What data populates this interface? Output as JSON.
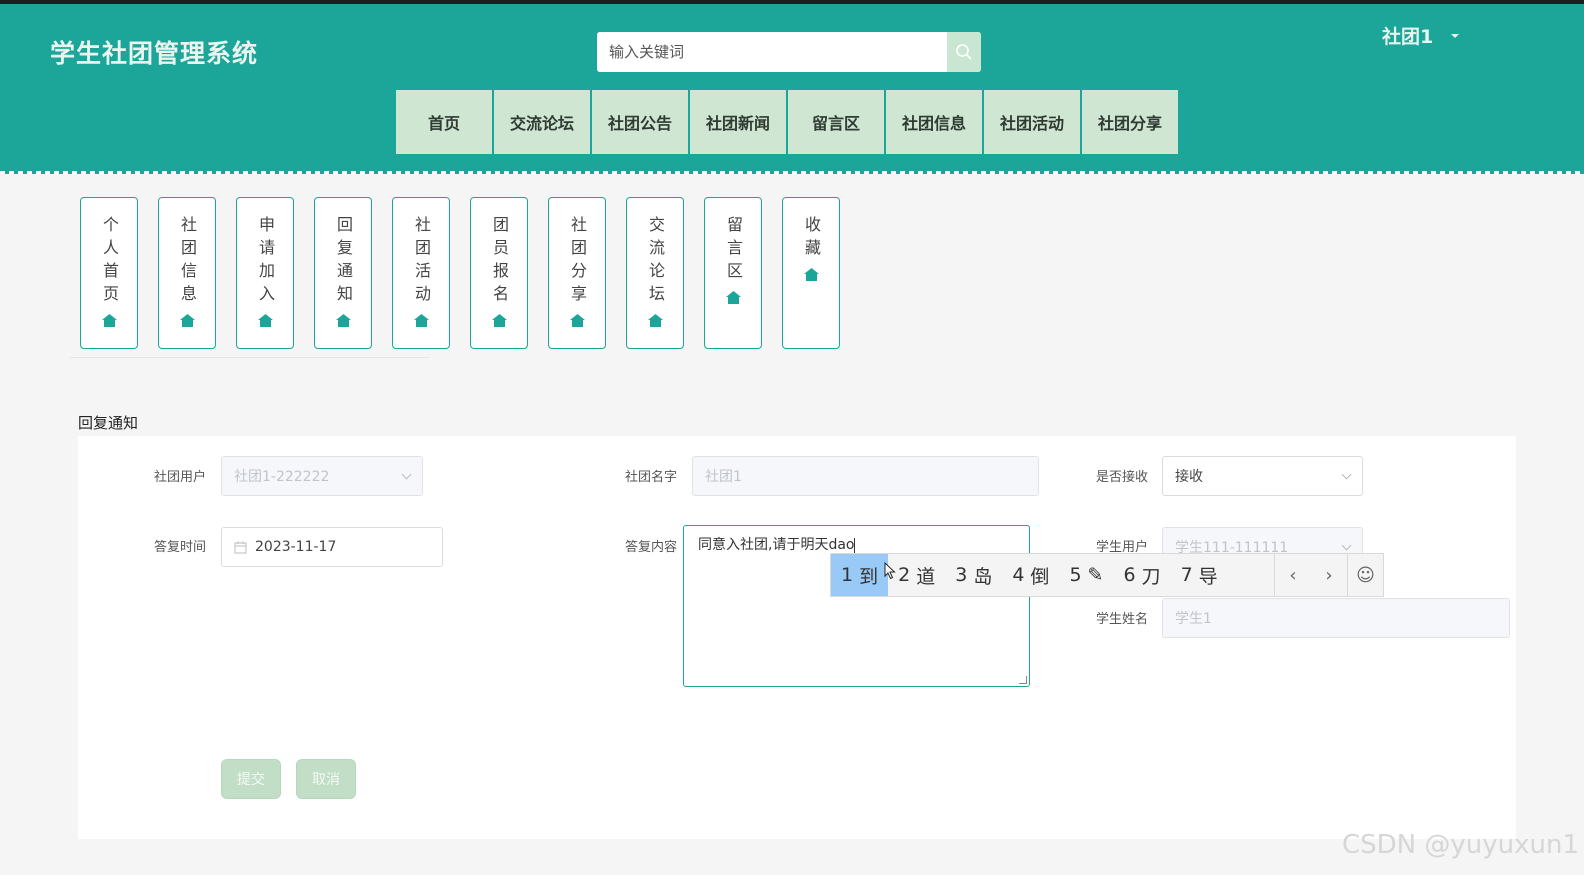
{
  "header": {
    "brand": "学生社团管理系统",
    "search_placeholder": "输入关键词",
    "user": "社团1",
    "nav": [
      "首页",
      "交流论坛",
      "社团公告",
      "社团新闻",
      "留言区",
      "社团信息",
      "社团活动",
      "社团分享"
    ]
  },
  "tiles": [
    "个人首页",
    "社团信息",
    "申请加入",
    "回复通知",
    "社团活动",
    "团员报名",
    "社团分享",
    "交流论坛",
    "留言区",
    "收藏"
  ],
  "form": {
    "title": "回复通知",
    "club_user_label": "社团用户",
    "club_user_value": "社团1-222222",
    "club_name_label": "社团名字",
    "club_name_value": "社团1",
    "accept_label": "是否接收",
    "accept_value": "接收",
    "reply_time_label": "答复时间",
    "reply_time_value": "2023-11-17",
    "reply_content_label": "答复内容",
    "reply_content_value": "同意入社团,请于明天dao",
    "student_user_label": "学生用户",
    "student_user_value": "学生111-111111",
    "student_name_label": "学生姓名",
    "student_name_value": "学生1",
    "submit_label": "提交",
    "cancel_label": "取消"
  },
  "ime": {
    "candidates": [
      {
        "num": "1",
        "text": "到"
      },
      {
        "num": "2",
        "text": "道"
      },
      {
        "num": "3",
        "text": "岛"
      },
      {
        "num": "4",
        "text": "倒"
      },
      {
        "num": "5",
        "text": "✎"
      },
      {
        "num": "6",
        "text": "刀"
      },
      {
        "num": "7",
        "text": "导"
      }
    ],
    "prev": "‹",
    "next": "›",
    "emoji": "☺"
  },
  "watermark": "CSDN @yuyuxun1",
  "colors": {
    "primary": "#1ba699",
    "nav_bg": "#cfe6d3",
    "button_bg": "#c2dec6",
    "ime_selected": "#99c9f7"
  }
}
